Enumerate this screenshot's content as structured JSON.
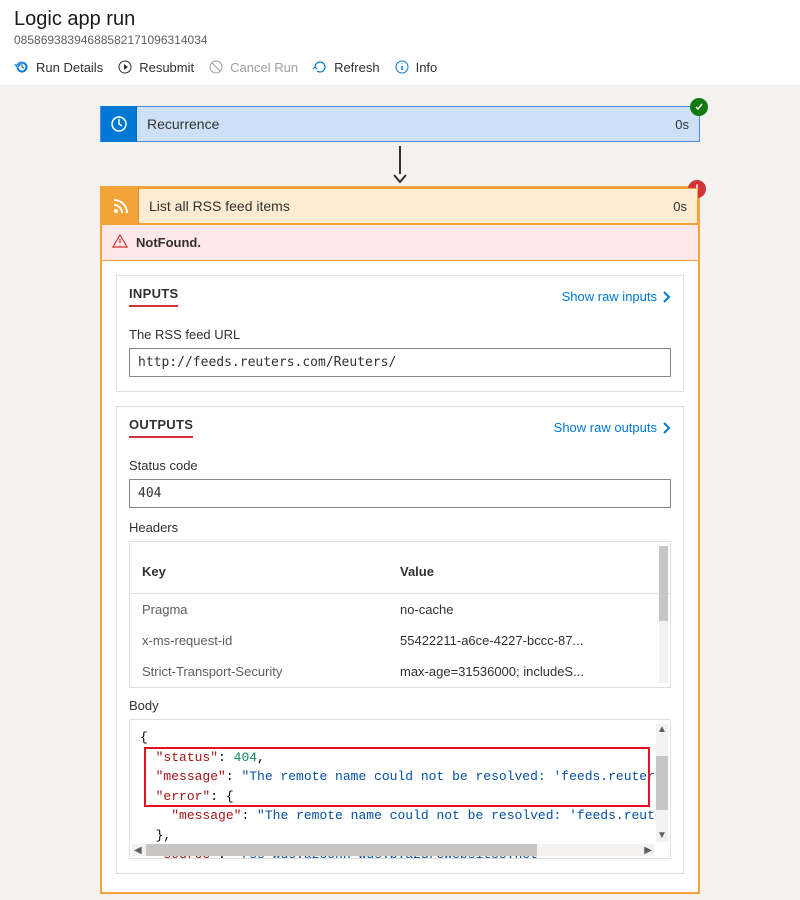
{
  "page_title": "Logic app run",
  "run_id": "08586938394688582171096314034",
  "toolbar": {
    "run_details": "Run Details",
    "resubmit": "Resubmit",
    "cancel_run": "Cancel Run",
    "refresh": "Refresh",
    "info": "Info"
  },
  "step_recurrence": {
    "title": "Recurrence",
    "time": "0s",
    "status": "success"
  },
  "step_rss": {
    "title": "List all RSS feed items",
    "time": "0s",
    "status": "error"
  },
  "error_strip": {
    "message": "NotFound."
  },
  "inputs": {
    "section_label": "INPUTS",
    "show_raw": "Show raw inputs",
    "url_label": "The RSS feed URL",
    "url_value": "http://feeds.reuters.com/Reuters/"
  },
  "outputs": {
    "section_label": "OUTPUTS",
    "show_raw": "Show raw outputs",
    "status_label": "Status code",
    "status_value": "404",
    "headers_label": "Headers",
    "col_key": "Key",
    "col_val": "Value",
    "rows": [
      {
        "k": "Pragma",
        "v": "no-cache"
      },
      {
        "k": "x-ms-request-id",
        "v": "55422211-a6ce-4227-bccc-87..."
      },
      {
        "k": "Strict-Transport-Security",
        "v": "max-age=31536000; includeS..."
      }
    ],
    "body_label": "Body",
    "body_json": {
      "l1": "{",
      "k_status": "\"status\"",
      "v_status": "404",
      "k_message": "\"message\"",
      "v_message": "\"The remote name could not be resolved: 'feeds.reuters",
      "k_error": "\"error\"",
      "k_inner_message": "\"message\"",
      "v_inner_message": "\"The remote name could not be resolved: 'feeds.reute",
      "close_brace": "},",
      "k_source": "\"source\"",
      "v_source": "\"rss-wus.azconn-wus.p.azurewebsites.net\""
    }
  }
}
